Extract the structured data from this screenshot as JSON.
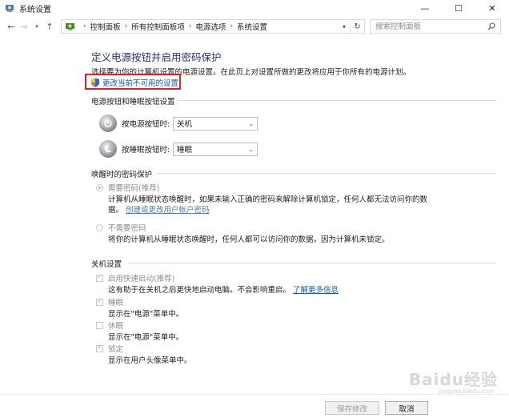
{
  "window": {
    "title": "系统设置"
  },
  "nav": {
    "breadcrumbs": [
      "控制面板",
      "所有控制面板项",
      "电源选项",
      "系统设置"
    ],
    "search_placeholder": "搜索控制面板"
  },
  "page": {
    "heading": "定义电源按钮并启用密码保护",
    "description": "选择要为你的计算机设置的电源设置。在此页上对设置所做的更改将应用于你所有的电源计划。",
    "change_link": "更改当前不可用的设置"
  },
  "power_buttons": {
    "section_title": "电源按钮和睡眠按钮设置",
    "power_label": "按电源按钮时:",
    "power_value": "关机",
    "sleep_label": "按睡眠按钮时:",
    "sleep_value": "睡眠"
  },
  "wake_password": {
    "section_title": "唤醒时的密码保护",
    "require_label": "需要密码(推荐)",
    "require_desc": "计算机从睡眠状态唤醒时，如果未输入正确的密码来解除计算机锁定，任何人都无法访问你的数",
    "require_desc2": "据。",
    "require_link": "创建或更改用户帐户密码",
    "norequire_label": "不需要密码",
    "norequire_desc": "将你的计算机从睡眠状态唤醒时，任何人都可以访问你的数据，因为计算机未锁定。"
  },
  "shutdown": {
    "section_title": "关机设置",
    "fast_label": "启用快速启动(推荐)",
    "fast_desc": "这有助于在关机之后更快地启动电脑。不会影响重启。",
    "fast_link": "了解更多信息",
    "sleep_label": "睡眠",
    "sleep_desc": "显示在\"电源\"菜单中。",
    "hibernate_label": "休眠",
    "hibernate_desc": "显示在\"电源\"菜单中。",
    "lock_label": "锁定",
    "lock_desc": "显示在用户头像菜单中。"
  },
  "footer": {
    "save_label": "保存修改",
    "cancel_label": "取消"
  },
  "watermark": {
    "brand": "Baidu经验",
    "site": "jingyan.baidu.com"
  },
  "colors": {
    "heading": "#1e3287",
    "link": "#0a58ca",
    "highlight": "#e31e24"
  }
}
